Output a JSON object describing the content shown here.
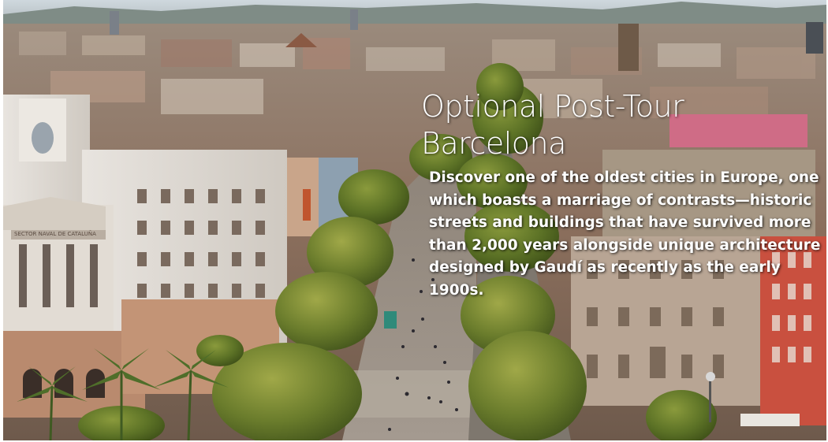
{
  "hero": {
    "title_line1": "Optional Post-Tour",
    "title_line2": "Barcelona",
    "description": "Discover one of the oldest cities in Europe, one which boasts a marriage of contrasts—historic streets and buildings that have survived more than 2,000 years alongside unique architecture designed by Gaudí as recently as the early 1900s."
  },
  "photo": {
    "subject": "aerial view of La Rambla boulevard in Barcelona",
    "sign_text": "SECTOR NAVAL DE CATALUÑA"
  },
  "colors": {
    "text": "#ffffff",
    "sky": "#c9d3da",
    "trees": "#5f7a2c",
    "promenade": "#9b8f83"
  }
}
